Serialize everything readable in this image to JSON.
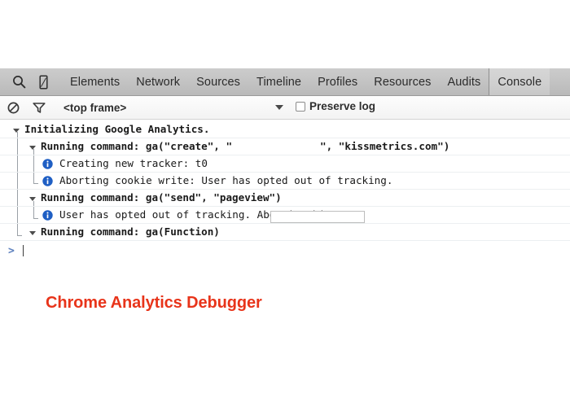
{
  "panel": {
    "tabbar": {
      "icons": [
        {
          "name": "search-icon",
          "label": "Inspect element"
        },
        {
          "name": "device-toggle-icon",
          "label": "Toggle device mode"
        }
      ],
      "tabs": [
        {
          "label": "Elements",
          "active": false
        },
        {
          "label": "Network",
          "active": false
        },
        {
          "label": "Sources",
          "active": false
        },
        {
          "label": "Timeline",
          "active": false
        },
        {
          "label": "Profiles",
          "active": false
        },
        {
          "label": "Resources",
          "active": false
        },
        {
          "label": "Audits",
          "active": false
        },
        {
          "label": "Console",
          "active": true
        }
      ]
    },
    "filterbar": {
      "clear_icon": "clear-console-icon",
      "filter_icon": "filter-funnel-icon",
      "context_value": "<top frame>",
      "dropdown_icon": "chevron-down-icon",
      "preserve_log_label": "Preserve log",
      "preserve_log_checked": false
    },
    "console": {
      "rows": [
        {
          "indent": 0,
          "marker": "triangle",
          "bold": true,
          "text": "Initializing Google Analytics."
        },
        {
          "indent": 1,
          "marker": "triangle",
          "bold": true,
          "text": "Running command: ga(\"create\", \"",
          "redacted": true,
          "text_after": "\", \"kissmetrics.com\")"
        },
        {
          "indent": 2,
          "marker": "info",
          "bold": false,
          "text": "Creating new tracker: t0"
        },
        {
          "indent": 2,
          "marker": "info",
          "bold": false,
          "text": "Aborting cookie write: User has opted out of tracking."
        },
        {
          "indent": 1,
          "marker": "triangle",
          "bold": true,
          "text": "Running command: ga(\"send\", \"pageview\")"
        },
        {
          "indent": 2,
          "marker": "info",
          "bold": false,
          "text": "User has opted out of tracking. Aborting hit."
        },
        {
          "indent": 1,
          "marker": "triangle",
          "bold": true,
          "text": "Running command: ga(Function)"
        }
      ],
      "prompt": {
        "arrow": ">",
        "input_value": "",
        "placeholder": ""
      }
    }
  },
  "caption": {
    "text": "Chrome Analytics Debugger",
    "color": "#e8341a"
  },
  "colors": {
    "tabbar_bg": "#c4c4c4",
    "info_icon": "#1f5fc4",
    "prompt_arrow": "#5b7fbd",
    "caption_red": "#e8341a"
  }
}
